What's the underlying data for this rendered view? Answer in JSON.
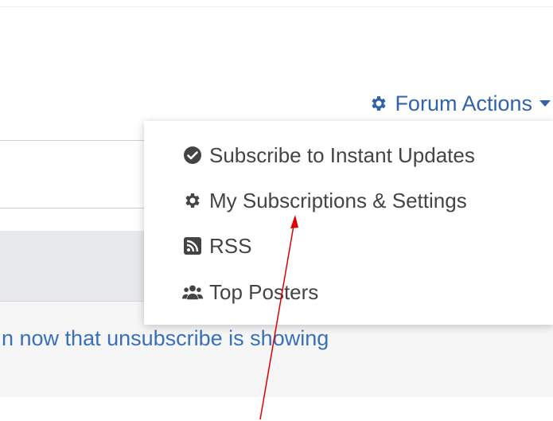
{
  "header": {
    "forum_actions_label": "Forum Actions",
    "icon": "gear-icon",
    "caret_icon": "caret-down-icon",
    "accent_color": "#2f64ad"
  },
  "dropdown": {
    "items": [
      {
        "label": "Subscribe to Instant Updates",
        "icon": "check-circle-icon"
      },
      {
        "label": "My Subscriptions & Settings",
        "icon": "gear-icon"
      },
      {
        "label": "RSS",
        "icon": "rss-icon"
      },
      {
        "label": "Top Posters",
        "icon": "users-icon"
      }
    ],
    "text_color": "#444444"
  },
  "background": {
    "post_snippet": "n now that unsubscribe is showing",
    "link_color": "#3a6fb9"
  },
  "annotation": {
    "arrow_color": "#e00000"
  }
}
